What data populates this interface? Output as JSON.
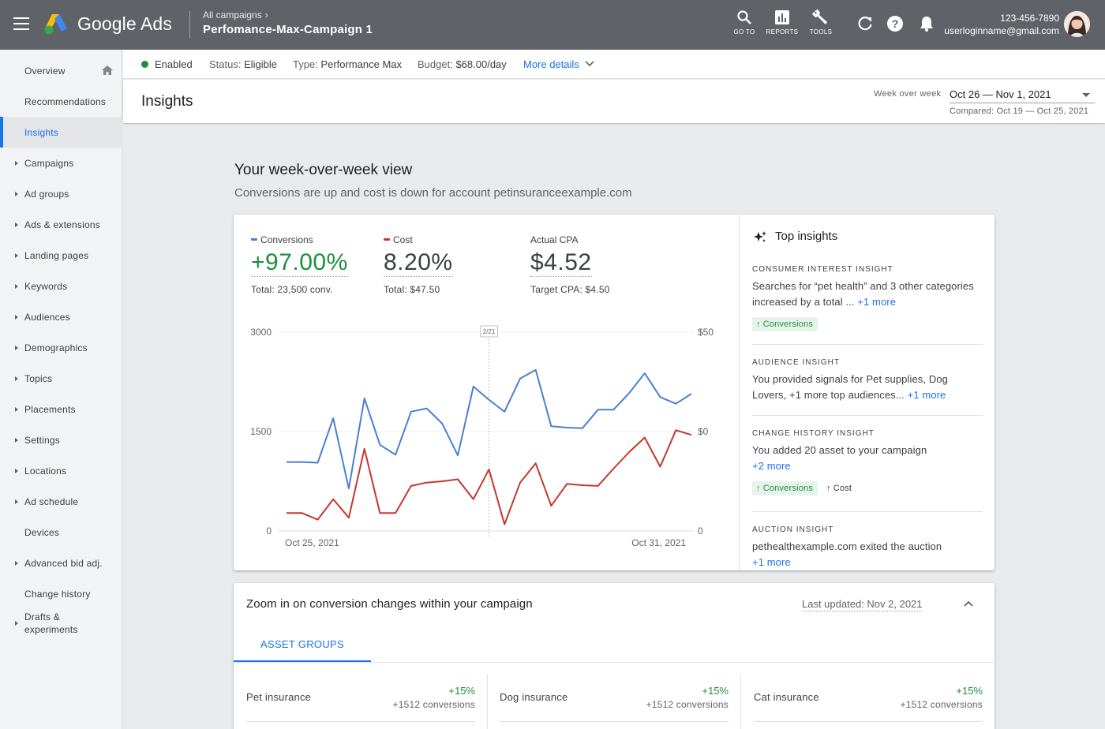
{
  "header": {
    "brand": "Google Ads",
    "breadcrumb": "All campaigns",
    "campaign_name": "Perfomance-Max-Campaign 1",
    "goto_label": "GO TO",
    "reports_label": "REPORTS",
    "tools_label": "TOOLS",
    "account_id": "123-456-7890",
    "account_email": "userloginname@gmail.com"
  },
  "sidebar": {
    "items": [
      {
        "label": "Overview"
      },
      {
        "label": "Recommendations"
      },
      {
        "label": "Insights"
      },
      {
        "label": "Campaigns"
      },
      {
        "label": "Ad groups"
      },
      {
        "label": "Ads & extensions"
      },
      {
        "label": "Landing pages"
      },
      {
        "label": "Keywords"
      },
      {
        "label": "Audiences"
      },
      {
        "label": "Demographics"
      },
      {
        "label": "Topics"
      },
      {
        "label": "Placements"
      },
      {
        "label": "Settings"
      },
      {
        "label": "Locations"
      },
      {
        "label": "Ad schedule"
      },
      {
        "label": "Devices"
      },
      {
        "label": "Advanced bid adj."
      },
      {
        "label": "Change history"
      },
      {
        "label": "Drafts & experiments"
      }
    ]
  },
  "status": {
    "enabled": "Enabled",
    "status_label": "Status:",
    "status_value": "Eligible",
    "type_label": "Type:",
    "type_value": "Performance Max",
    "budget_label": "Budget:",
    "budget_value": "$68.00/day",
    "more_details": "More details"
  },
  "insights_header": {
    "title": "Insights",
    "week_label": "Week over week",
    "date_range": "Oct 26 — Nov 1, 2021",
    "compared": "Compared: Oct 19 — Oct 25, 2021"
  },
  "section": {
    "title": "Your week-over-week view",
    "subtitle": "Conversions are up and cost is down for account petinsuranceexample.com"
  },
  "metrics": {
    "conversions": {
      "label": "Conversions",
      "value": "+97.00%",
      "sub": "Total: 23,500 conv."
    },
    "cost": {
      "label": "Cost",
      "value": "8.20%",
      "sub": "Total: $47.50"
    },
    "cpa": {
      "label": "Actual CPA",
      "value": "$4.52",
      "sub": "Target CPA: $4.50"
    }
  },
  "colors": {
    "conversions": "#4a7fd4",
    "cost": "#c5362e",
    "positive": "#1e8e3e",
    "accent": "#1a73e8"
  },
  "chart_data": {
    "type": "line",
    "x_start_label": "Oct 25, 2021",
    "x_end_label": "Oct 31, 2021",
    "marker_label": "2/21",
    "marker_index": 13,
    "y_left_ticks": [
      "3000",
      "1500",
      "0"
    ],
    "y_right_ticks": [
      "$50",
      "$0",
      "0"
    ],
    "ylim": [
      0,
      3000
    ],
    "series": [
      {
        "name": "Conversions",
        "values": [
          1040,
          1040,
          1030,
          1700,
          640,
          2000,
          1300,
          1150,
          1800,
          1850,
          1620,
          1140,
          2180,
          1980,
          1800,
          2300,
          2430,
          1580,
          1560,
          1550,
          1830,
          1830,
          2080,
          2380,
          2020,
          1920,
          2070
        ]
      },
      {
        "name": "Cost",
        "values": [
          270,
          270,
          170,
          480,
          200,
          1240,
          270,
          270,
          680,
          730,
          750,
          780,
          480,
          930,
          100,
          730,
          1020,
          380,
          710,
          690,
          680,
          940,
          1190,
          1410,
          970,
          1520,
          1450
        ]
      }
    ]
  },
  "top_insights": {
    "title": "Top insights",
    "items": [
      {
        "header": "CONSUMER INTEREST INSIGHT",
        "body": "Searches for “pet health” and 3 other categories increased by a total ...",
        "more": "+1 more",
        "chips": [
          "Conversions"
        ]
      },
      {
        "header": "AUDIENCE INSIGHT",
        "body": "You provided signals for Pet supplies, Dog Lovers, +1 more top audiences...",
        "more": "+1 more"
      },
      {
        "header": "CHANGE HISTORY INSIGHT",
        "body": "You added 20 asset to your campaign",
        "more": "+2 more",
        "chips": [
          "Conversions",
          "Cost"
        ]
      },
      {
        "header": "AUCTION INSIGHT",
        "body": "pethealthexample.com exited the auction",
        "more": "+1 more"
      }
    ]
  },
  "zoom": {
    "title": "Zoom in on conversion changes within your campaign",
    "last_updated": "Last updated: Nov 2, 2021",
    "tab": "ASSET GROUPS",
    "groups": [
      {
        "name": "Pet insurance",
        "pct": "+15%",
        "conv": "+1512 conversions"
      },
      {
        "name": "Dog insurance",
        "pct": "+15%",
        "conv": "+1512 conversions"
      },
      {
        "name": "Cat insurance",
        "pct": "+15%",
        "conv": "+1512 conversions"
      }
    ]
  }
}
